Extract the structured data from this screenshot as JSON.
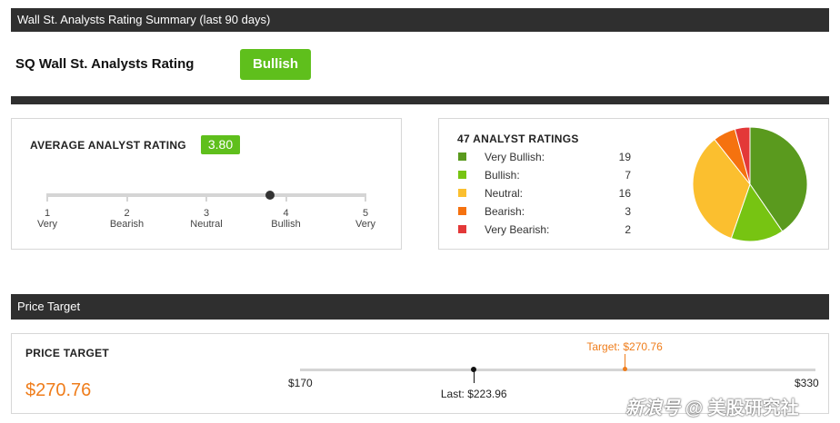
{
  "summary": {
    "header": "Wall St. Analysts Rating Summary (last 90 days)",
    "title": "SQ Wall St. Analysts Rating",
    "badge": "Bullish"
  },
  "avg_rating": {
    "title": "AVERAGE ANALYST RATING",
    "value": "3.80",
    "value_num": 3.8,
    "scale": [
      {
        "num": "1",
        "label": "Very"
      },
      {
        "num": "2",
        "label": "Bearish"
      },
      {
        "num": "3",
        "label": "Neutral"
      },
      {
        "num": "4",
        "label": "Bullish"
      },
      {
        "num": "5",
        "label": "Very"
      }
    ]
  },
  "breakdown": {
    "title": "47 ANALYST RATINGS",
    "items": [
      {
        "label": "Very Bullish:",
        "count": "19",
        "value": 19,
        "color": "#5a9a1e"
      },
      {
        "label": "Bullish:",
        "count": "7",
        "value": 7,
        "color": "#77c412"
      },
      {
        "label": "Neutral:",
        "count": "16",
        "value": 16,
        "color": "#fbbf2f"
      },
      {
        "label": "Bearish:",
        "count": "3",
        "value": 3,
        "color": "#f5720f"
      },
      {
        "label": "Very Bearish:",
        "count": "2",
        "value": 2,
        "color": "#e33838"
      }
    ]
  },
  "price_target": {
    "header": "Price Target",
    "title": "PRICE TARGET",
    "value": "$270.76",
    "min_label": "$170",
    "max_label": "$330",
    "min": 170,
    "max": 330,
    "target_label": "Target: $270.76",
    "target": 270.76,
    "last_label": "Last: $223.96",
    "last": 223.96,
    "accent": "#ef7d1b"
  },
  "watermark": "美股研究社",
  "watermark_brand": "新浪号"
}
